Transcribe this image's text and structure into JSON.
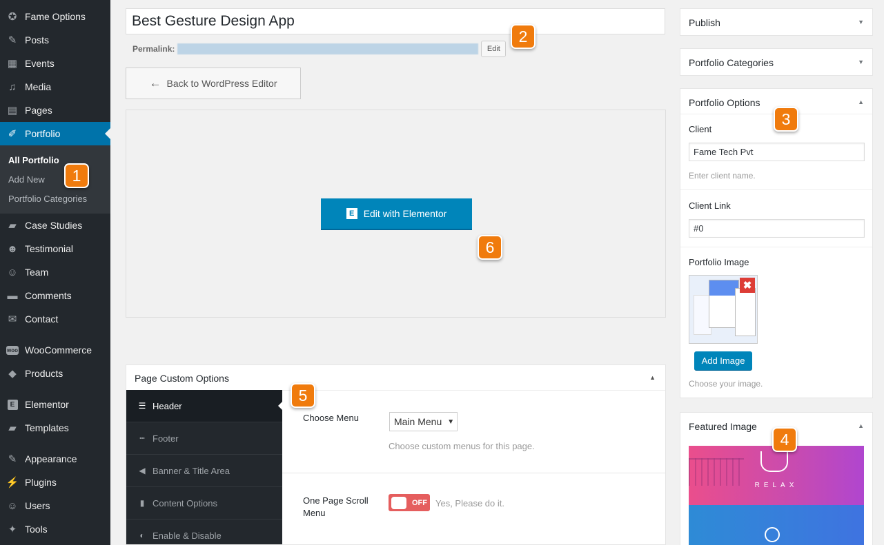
{
  "sidebar": {
    "items": [
      {
        "label": "Fame Options",
        "icon": "award-icon"
      },
      {
        "label": "Posts",
        "icon": "pin-icon"
      },
      {
        "label": "Events",
        "icon": "calendar-icon"
      },
      {
        "label": "Media",
        "icon": "media-icon"
      },
      {
        "label": "Pages",
        "icon": "pages-icon"
      },
      {
        "label": "Portfolio",
        "icon": "portfolio-icon"
      },
      {
        "label": "Case Studies",
        "icon": "folder-icon"
      },
      {
        "label": "Testimonial",
        "icon": "group-icon"
      },
      {
        "label": "Team",
        "icon": "user-icon"
      },
      {
        "label": "Comments",
        "icon": "comment-icon"
      },
      {
        "label": "Contact",
        "icon": "mail-icon"
      },
      {
        "label": "WooCommerce",
        "icon": "woocommerce-icon",
        "icon_text": "woo"
      },
      {
        "label": "Products",
        "icon": "cube-icon"
      },
      {
        "label": "Elementor",
        "icon": "elementor-icon",
        "icon_text": "E"
      },
      {
        "label": "Templates",
        "icon": "folder-open-icon"
      },
      {
        "label": "Appearance",
        "icon": "brush-icon"
      },
      {
        "label": "Plugins",
        "icon": "plug-icon"
      },
      {
        "label": "Users",
        "icon": "user-icon"
      },
      {
        "label": "Tools",
        "icon": "wrench-icon"
      }
    ],
    "submenu": [
      "All Portfolio",
      "Add New",
      "Portfolio Categories"
    ]
  },
  "editor": {
    "title": "Best Gesture Design App",
    "permalink_label": "Permalink:",
    "edit_label": "Edit",
    "back_label": "Back to WordPress Editor",
    "elementor_label": "Edit with Elementor",
    "elementor_logo": "E"
  },
  "page_options": {
    "title": "Page Custom Options",
    "tabs": [
      "Header",
      "Footer",
      "Banner & Title Area",
      "Content Options",
      "Enable & Disable"
    ],
    "choose_menu_label": "Choose Menu",
    "menu_value": "Main Menu",
    "menu_desc": "Choose custom menus for this page.",
    "scroll_label_1": "One Page Scroll",
    "scroll_label_2": "Menu",
    "toggle_text": "OFF",
    "scroll_desc": "Yes, Please do it."
  },
  "right": {
    "publish": "Publish",
    "categories": "Portfolio Categories",
    "options_title": "Portfolio Options",
    "client_label": "Client",
    "client_value": "Fame Tech Pvt",
    "client_desc": "Enter client name.",
    "client_link_label": "Client Link",
    "client_link_value": "#0",
    "image_label": "Portfolio Image",
    "remove_glyph": "✖",
    "add_image": "Add Image",
    "image_desc": "Choose your image.",
    "featured_title": "Featured Image",
    "featured_caption": "RELAX"
  },
  "badges": [
    "1",
    "2",
    "3",
    "4",
    "5",
    "6"
  ],
  "colors": {
    "accent": "#0073aa",
    "button": "#0085ba",
    "badge": "#f07b0d",
    "toggle_off": "#e55e5e"
  }
}
